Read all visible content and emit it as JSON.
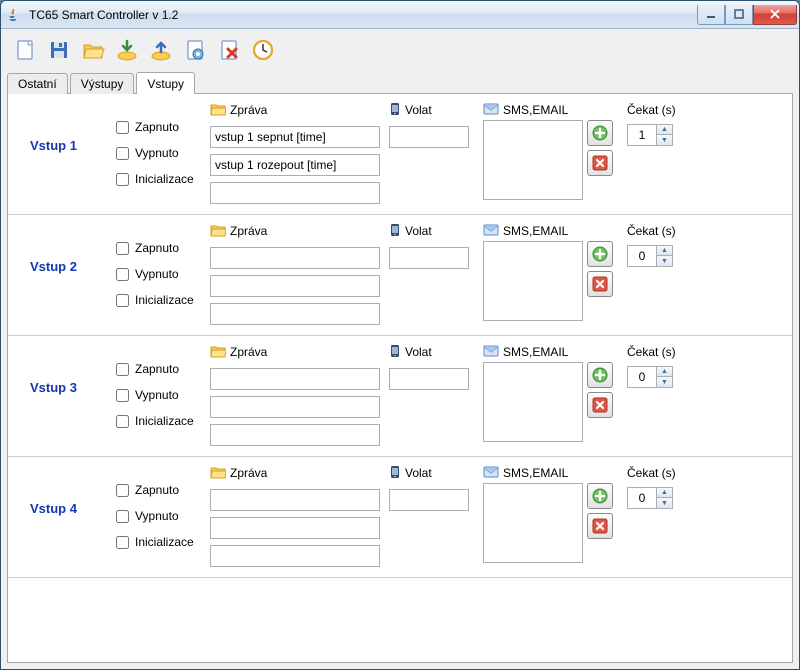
{
  "window": {
    "title": "TC65 Smart Controller v 1.2"
  },
  "tabs": {
    "ostatni": "Ostatní",
    "vystupy": "Výstupy",
    "vstupy": "Vstupy"
  },
  "labels": {
    "zapnuto": "Zapnuto",
    "vypnuto": "Vypnuto",
    "inicializace": "Inicializace",
    "zprava": "Zpráva",
    "volat": "Volat",
    "smsemail": "SMS,EMAIL",
    "cekat": "Čekat (s)"
  },
  "inputs": [
    {
      "name": "Vstup 1",
      "zapnuto": false,
      "vypnuto": false,
      "init": false,
      "msg1": "vstup 1 sepnut [time]",
      "msg2": "vstup 1 rozepout [time]",
      "msg3": "",
      "volat": "",
      "wait": "1"
    },
    {
      "name": "Vstup 2",
      "zapnuto": false,
      "vypnuto": false,
      "init": false,
      "msg1": "",
      "msg2": "",
      "msg3": "",
      "volat": "",
      "wait": "0"
    },
    {
      "name": "Vstup 3",
      "zapnuto": false,
      "vypnuto": false,
      "init": false,
      "msg1": "",
      "msg2": "",
      "msg3": "",
      "volat": "",
      "wait": "0"
    },
    {
      "name": "Vstup 4",
      "zapnuto": false,
      "vypnuto": false,
      "init": false,
      "msg1": "",
      "msg2": "",
      "msg3": "",
      "volat": "",
      "wait": "0"
    }
  ]
}
